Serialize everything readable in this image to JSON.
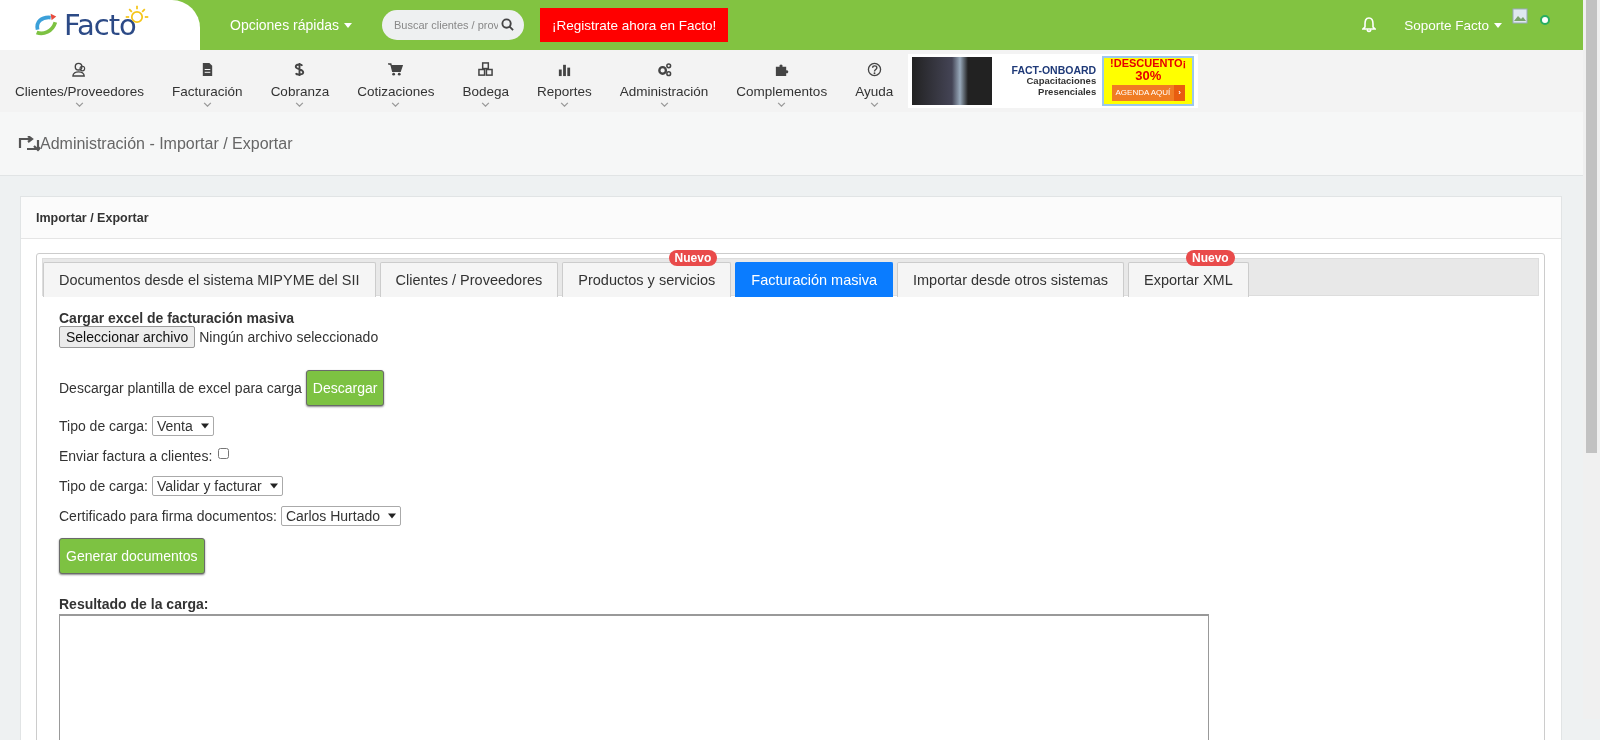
{
  "topbar": {
    "logo": "Facto",
    "quick_options": "Opciones rápidas",
    "search": {
      "placeholder": "Buscar clientes / prov"
    },
    "register": "¡Registrate ahora en Facto!",
    "user": "Soporte Facto",
    "online": true
  },
  "nav": [
    {
      "label": "Clientes/Proveedores"
    },
    {
      "label": "Facturación"
    },
    {
      "label": "Cobranza"
    },
    {
      "label": "Cotizaciones"
    },
    {
      "label": "Bodega"
    },
    {
      "label": "Reportes"
    },
    {
      "label": "Administración"
    },
    {
      "label": "Complementos"
    },
    {
      "label": "Ayuda"
    }
  ],
  "banner": {
    "title": "FACT-ONBOARD",
    "subtitle": "Capacitaciones Presenciales",
    "discount": "!DESCUENTO¡",
    "percent": "30%",
    "cta": "AGENDA AQUÍ",
    "cta_arrow": "›"
  },
  "page_title": "Administración - Importar / Exportar",
  "card": {
    "title": "Importar / Exportar",
    "tabs": [
      {
        "label": "Documentos desde el sistema MIPYME del SII",
        "selected": false
      },
      {
        "label": "Clientes / Proveedores",
        "selected": false
      },
      {
        "label": "Productos y servicios",
        "selected": false,
        "badge": "Nuevo"
      },
      {
        "label": "Facturación masiva",
        "selected": true
      },
      {
        "label": "Importar desde otros sistemas",
        "selected": false
      },
      {
        "label": "Exportar XML",
        "selected": false,
        "badge": "Nuevo"
      }
    ],
    "upload": {
      "heading": "Cargar excel de facturación masiva",
      "button": "Seleccionar archivo",
      "status": "Ningún archivo seleccionado"
    },
    "download": {
      "label": "Descargar plantilla de excel para carga",
      "button": "Descargar"
    },
    "fields": [
      {
        "kind": "select",
        "label": "Tipo de carga:",
        "value": "Venta"
      },
      {
        "kind": "checkbox",
        "label": "Enviar factura a clientes:",
        "checked": false
      },
      {
        "kind": "select",
        "label": "Tipo de carga:",
        "value": "Validar y facturar"
      },
      {
        "kind": "select",
        "label": "Certificado para firma documentos:",
        "value": "Carlos Hurtado"
      }
    ],
    "generate": "Generar documentos",
    "result_label": "Resultado de la carga:"
  }
}
